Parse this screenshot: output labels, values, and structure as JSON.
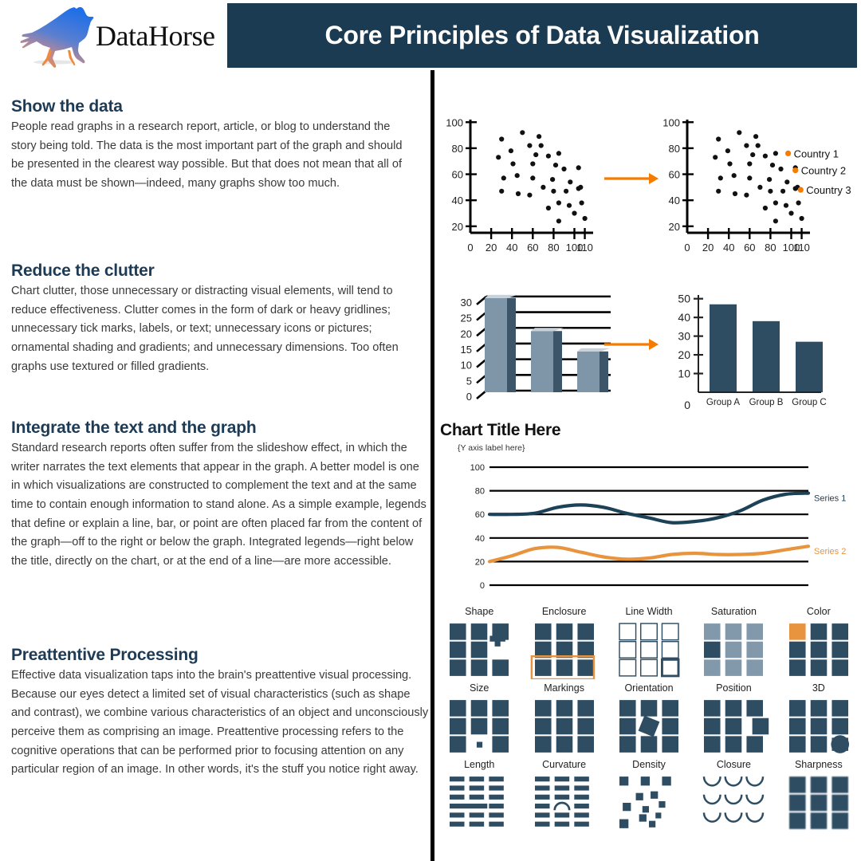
{
  "header": {
    "brand": "DataHorse",
    "title": "Core Principles of Data Visualization",
    "logo_icon": "galloping-horse-logo",
    "colors": {
      "navy": "#1a3b52",
      "orange": "#e8943f",
      "arrow_orange": "#F57C00",
      "steel": "#7f95a8"
    }
  },
  "sections": [
    {
      "heading": "Show the data",
      "body": "People read graphs in a research report, article, or blog to understand the story being told. The data is the most important part of the graph and should be presented in the clearest way possible. But that does not mean that all of the data must be shown—indeed, many graphs show too much."
    },
    {
      "heading": "Reduce the clutter",
      "body": "Chart clutter, those unnecessary or distracting visual elements, will tend to reduce effectiveness. Clutter comes in the form of dark or heavy gridlines; unnecessary tick marks, labels, or text; unnecessary icons or pictures; ornamental shading and gradients; and unnecessary dimensions. Too often graphs use textured or filled gradients."
    },
    {
      "heading": "Integrate the text and the graph",
      "body": "Standard research reports often suffer from the slideshow effect, in which the writer narrates the text elements that appear in the graph. A better model is one in which visualizations are constructed to complement the text and at the same time to contain enough information to stand alone. As a simple example, legends that define or explain a line, bar, or point are often placed far from the content of the graph—off to the right or below the graph. Integrated legends—right below the title, directly on the chart, or at the end of a line—are more accessible."
    },
    {
      "heading": "Preattentive Processing",
      "body": "Effective data visualization taps into the brain's preattentive visual processing. Because our eyes detect a limited set of visual characteristics (such as shape and contrast), we combine various characteristics of an object and unconsciously perceive them as comprising an image. Preattentive processing refers to the cognitive operations that can be performed prior to focusing attention on any particular region of an image. In other words, it's the stuff you notice right away."
    }
  ],
  "chart_data": [
    {
      "type": "scatter",
      "name": "scatter-before",
      "title": "",
      "xlabel": "",
      "ylabel": "",
      "xticks": [
        0,
        20,
        40,
        60,
        80,
        100,
        110
      ],
      "yticks": [
        20,
        40,
        60,
        80,
        100
      ],
      "xlim": [
        0,
        118
      ],
      "ylim": [
        15,
        102
      ],
      "grid": false,
      "legend": null,
      "points": [
        [
          30,
          87
        ],
        [
          50,
          92
        ],
        [
          66,
          89
        ],
        [
          27,
          73
        ],
        [
          39,
          78
        ],
        [
          57,
          82
        ],
        [
          68,
          82
        ],
        [
          85,
          76
        ],
        [
          41,
          68
        ],
        [
          60,
          68
        ],
        [
          75,
          74
        ],
        [
          82,
          67
        ],
        [
          63,
          75
        ],
        [
          90,
          64
        ],
        [
          104,
          65
        ],
        [
          32,
          57
        ],
        [
          45,
          59
        ],
        [
          60,
          57
        ],
        [
          79,
          56
        ],
        [
          96,
          54
        ],
        [
          106,
          50
        ],
        [
          30,
          47
        ],
        [
          46,
          45
        ],
        [
          57,
          44
        ],
        [
          70,
          50
        ],
        [
          80,
          47
        ],
        [
          92,
          47
        ],
        [
          104,
          49
        ],
        [
          85,
          38
        ],
        [
          95,
          36
        ],
        [
          107,
          38
        ],
        [
          75,
          34
        ],
        [
          100,
          30
        ],
        [
          110,
          26
        ],
        [
          85,
          24
        ]
      ]
    },
    {
      "type": "scatter",
      "name": "scatter-after",
      "title": "",
      "xlabel": "",
      "ylabel": "",
      "xticks": [
        0,
        20,
        40,
        60,
        80,
        100,
        110
      ],
      "yticks": [
        20,
        40,
        60,
        80,
        100
      ],
      "xlim": [
        0,
        118
      ],
      "ylim": [
        15,
        102
      ],
      "grid": false,
      "legend": {
        "position": "inline-right",
        "entries": [
          "Country 1",
          "Country 2",
          "Country 3"
        ]
      },
      "highlight_points": [
        {
          "label": "Country 1",
          "x": 97,
          "y": 76,
          "color": "#F57C00"
        },
        {
          "label": "Country 2",
          "x": 104,
          "y": 63,
          "color": "#F57C00"
        },
        {
          "label": "Country 3",
          "x": 109,
          "y": 48,
          "color": "#F57C00"
        }
      ],
      "points": [
        [
          30,
          87
        ],
        [
          50,
          92
        ],
        [
          66,
          89
        ],
        [
          27,
          73
        ],
        [
          39,
          78
        ],
        [
          57,
          82
        ],
        [
          68,
          82
        ],
        [
          85,
          76
        ],
        [
          41,
          68
        ],
        [
          60,
          68
        ],
        [
          75,
          74
        ],
        [
          82,
          67
        ],
        [
          63,
          75
        ],
        [
          90,
          64
        ],
        [
          104,
          65
        ],
        [
          32,
          57
        ],
        [
          45,
          59
        ],
        [
          60,
          57
        ],
        [
          79,
          56
        ],
        [
          96,
          54
        ],
        [
          106,
          50
        ],
        [
          30,
          47
        ],
        [
          46,
          45
        ],
        [
          57,
          44
        ],
        [
          70,
          50
        ],
        [
          80,
          47
        ],
        [
          92,
          47
        ],
        [
          104,
          49
        ],
        [
          85,
          38
        ],
        [
          95,
          36
        ],
        [
          107,
          38
        ],
        [
          75,
          34
        ],
        [
          100,
          30
        ],
        [
          110,
          26
        ],
        [
          85,
          24
        ]
      ]
    },
    {
      "type": "bar",
      "name": "bar-cluttered",
      "title": "",
      "categories": [
        "",
        "",
        ""
      ],
      "values": [
        30,
        19.5,
        13
      ],
      "xlabel": "",
      "ylabel": "",
      "yticks": [
        0,
        5,
        10,
        15,
        20,
        25,
        30
      ],
      "ylim": [
        0,
        32
      ],
      "grid": true,
      "style_notes": "heavy dark gridlines, 3D shaded bars, skewed axis"
    },
    {
      "type": "bar",
      "name": "bar-clean",
      "title": "",
      "categories": [
        "Group A",
        "Group B",
        "Group C"
      ],
      "values": [
        47,
        38,
        27
      ],
      "xlabel": "",
      "ylabel": "",
      "yticks": [
        0,
        10,
        20,
        30,
        40,
        50
      ],
      "ylim": [
        0,
        52
      ],
      "grid": false,
      "style_notes": "flat solid bars, no gridlines"
    },
    {
      "type": "line",
      "name": "line-integrated-legend",
      "title": "Chart Title Here",
      "ylabel": "{Y axis label here}",
      "xlabel": "",
      "yticks": [
        0,
        20,
        40,
        60,
        80,
        100
      ],
      "ylim": [
        0,
        100
      ],
      "grid": true,
      "legend": {
        "position": "end-of-line",
        "entries": [
          "Series 1",
          "Series 2"
        ]
      },
      "series": [
        {
          "name": "Series 1",
          "color": "#1d4257",
          "values": [
            60,
            60,
            61,
            66,
            68,
            66,
            61,
            57,
            53,
            54,
            57,
            63,
            72,
            77,
            78
          ]
        },
        {
          "name": "Series 2",
          "color": "#e8943f",
          "values": [
            20,
            25,
            31,
            32,
            28,
            24,
            22,
            23,
            26,
            27,
            26,
            26,
            27,
            30,
            33
          ]
        }
      ]
    }
  ],
  "preattentive": {
    "rows": [
      [
        {
          "label": "Shape",
          "variant": "shape"
        },
        {
          "label": "Enclosure",
          "variant": "enclosure"
        },
        {
          "label": "Line Width",
          "variant": "line-width"
        },
        {
          "label": "Saturation",
          "variant": "saturation"
        },
        {
          "label": "Color",
          "variant": "color"
        }
      ],
      [
        {
          "label": "Size",
          "variant": "size"
        },
        {
          "label": "Markings",
          "variant": "markings"
        },
        {
          "label": "Orientation",
          "variant": "orientation"
        },
        {
          "label": "Position",
          "variant": "position"
        },
        {
          "label": "3D",
          "variant": "threed"
        }
      ],
      [
        {
          "label": "Length",
          "variant": "length"
        },
        {
          "label": "Curvature",
          "variant": "curvature"
        },
        {
          "label": "Density",
          "variant": "density"
        },
        {
          "label": "Closure",
          "variant": "closure"
        },
        {
          "label": "Sharpness",
          "variant": "sharpness"
        }
      ]
    ]
  }
}
